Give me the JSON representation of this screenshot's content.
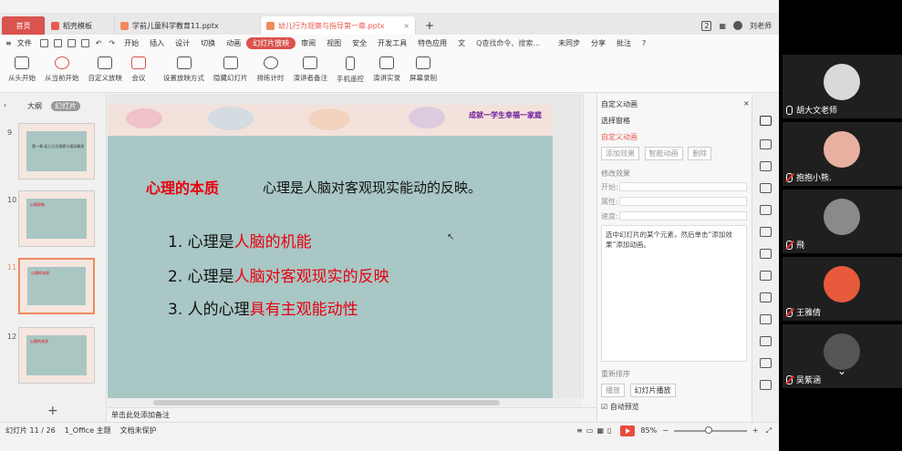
{
  "tabs": {
    "home": "首页",
    "items": [
      {
        "label": "稻壳模板",
        "icon_color": "#e85a4f"
      },
      {
        "label": "学前儿童科学教育11.pptx",
        "icon_color": "#f08a5d"
      },
      {
        "label": "幼儿行为观察与指导第一章.pptx",
        "icon_color": "#f08a5d",
        "active": true
      }
    ],
    "add": "+",
    "badge": "2",
    "user": "刘老师"
  },
  "menu": {
    "file": "文件",
    "items": [
      "开始",
      "插入",
      "设计",
      "切换",
      "动画",
      "幻灯片放映",
      "审阅",
      "视图",
      "安全",
      "开发工具",
      "特色应用",
      "文"
    ],
    "active": "幻灯片放映",
    "search": "Q查找命令、搜索...",
    "right": [
      "未同步",
      "分享",
      "批注"
    ]
  },
  "ribbon": [
    "从头开始",
    "从当前开始",
    "自定义放映",
    "会议",
    "设置放映方式",
    "隐藏幻灯片",
    "排练计时",
    "演讲者备注",
    "手机遥控",
    "演讲实录",
    "屏幕录制"
  ],
  "leftpanel": {
    "tab_outline": "大纲",
    "tab_slides": "幻灯片",
    "slides": [
      {
        "num": "9",
        "text": "第一章 幼儿行为观察与指导概述"
      },
      {
        "num": "10",
        "text": "心理现象"
      },
      {
        "num": "11",
        "text": "心理的本质",
        "selected": true
      },
      {
        "num": "12",
        "text": "心理的本质"
      }
    ],
    "add": "+"
  },
  "slide": {
    "banner": "成就一学生幸福一家庭",
    "concept_label": "心理的本质",
    "concept_text": "心理是人脑对客观现实能动的反映。",
    "points": [
      {
        "prefix": "1. 心理是",
        "highlight": "人脑的机能"
      },
      {
        "prefix": "2. 心理是",
        "highlight": "人脑对客观现实的反映"
      },
      {
        "prefix": "3. 人的心理",
        "highlight": "具有主观能动性"
      }
    ]
  },
  "notes": "单击此处添加备注",
  "rightpanel": {
    "title": "自定义动画",
    "select_pane": "选择窗格",
    "section": "自定义动画",
    "add_effect": "添加效果",
    "smart_anim": "智能动画",
    "delete": "删除",
    "modify": "修改效果",
    "start": "开始:",
    "property": "属性:",
    "speed": "速度:",
    "hint": "选中幻灯片的某个元素，然后单击“添加效果”添加动画。",
    "reorder": "重新排序",
    "play": "播放",
    "slideshow": "幻灯片播放",
    "autopreview": "自动预览"
  },
  "status": {
    "slide": "幻灯片 11 / 26",
    "theme": "1_Office 主题",
    "missing_font": "文档未保护",
    "zoom": "85%"
  },
  "participants": [
    {
      "name": "胡大文老师",
      "mic": "on",
      "avatar_color": "#d9d9d9"
    },
    {
      "name": "抱抱小熊.",
      "mic": "off",
      "avatar_color": "#e8b0a0"
    },
    {
      "name": "飛",
      "mic": "off",
      "avatar_color": "#8a8a8a"
    },
    {
      "name": "王雅倩",
      "mic": "off",
      "avatar_color": "#e85a3c"
    },
    {
      "name": "吴紫涵",
      "mic": "off",
      "avatar_color": "#555555"
    }
  ]
}
